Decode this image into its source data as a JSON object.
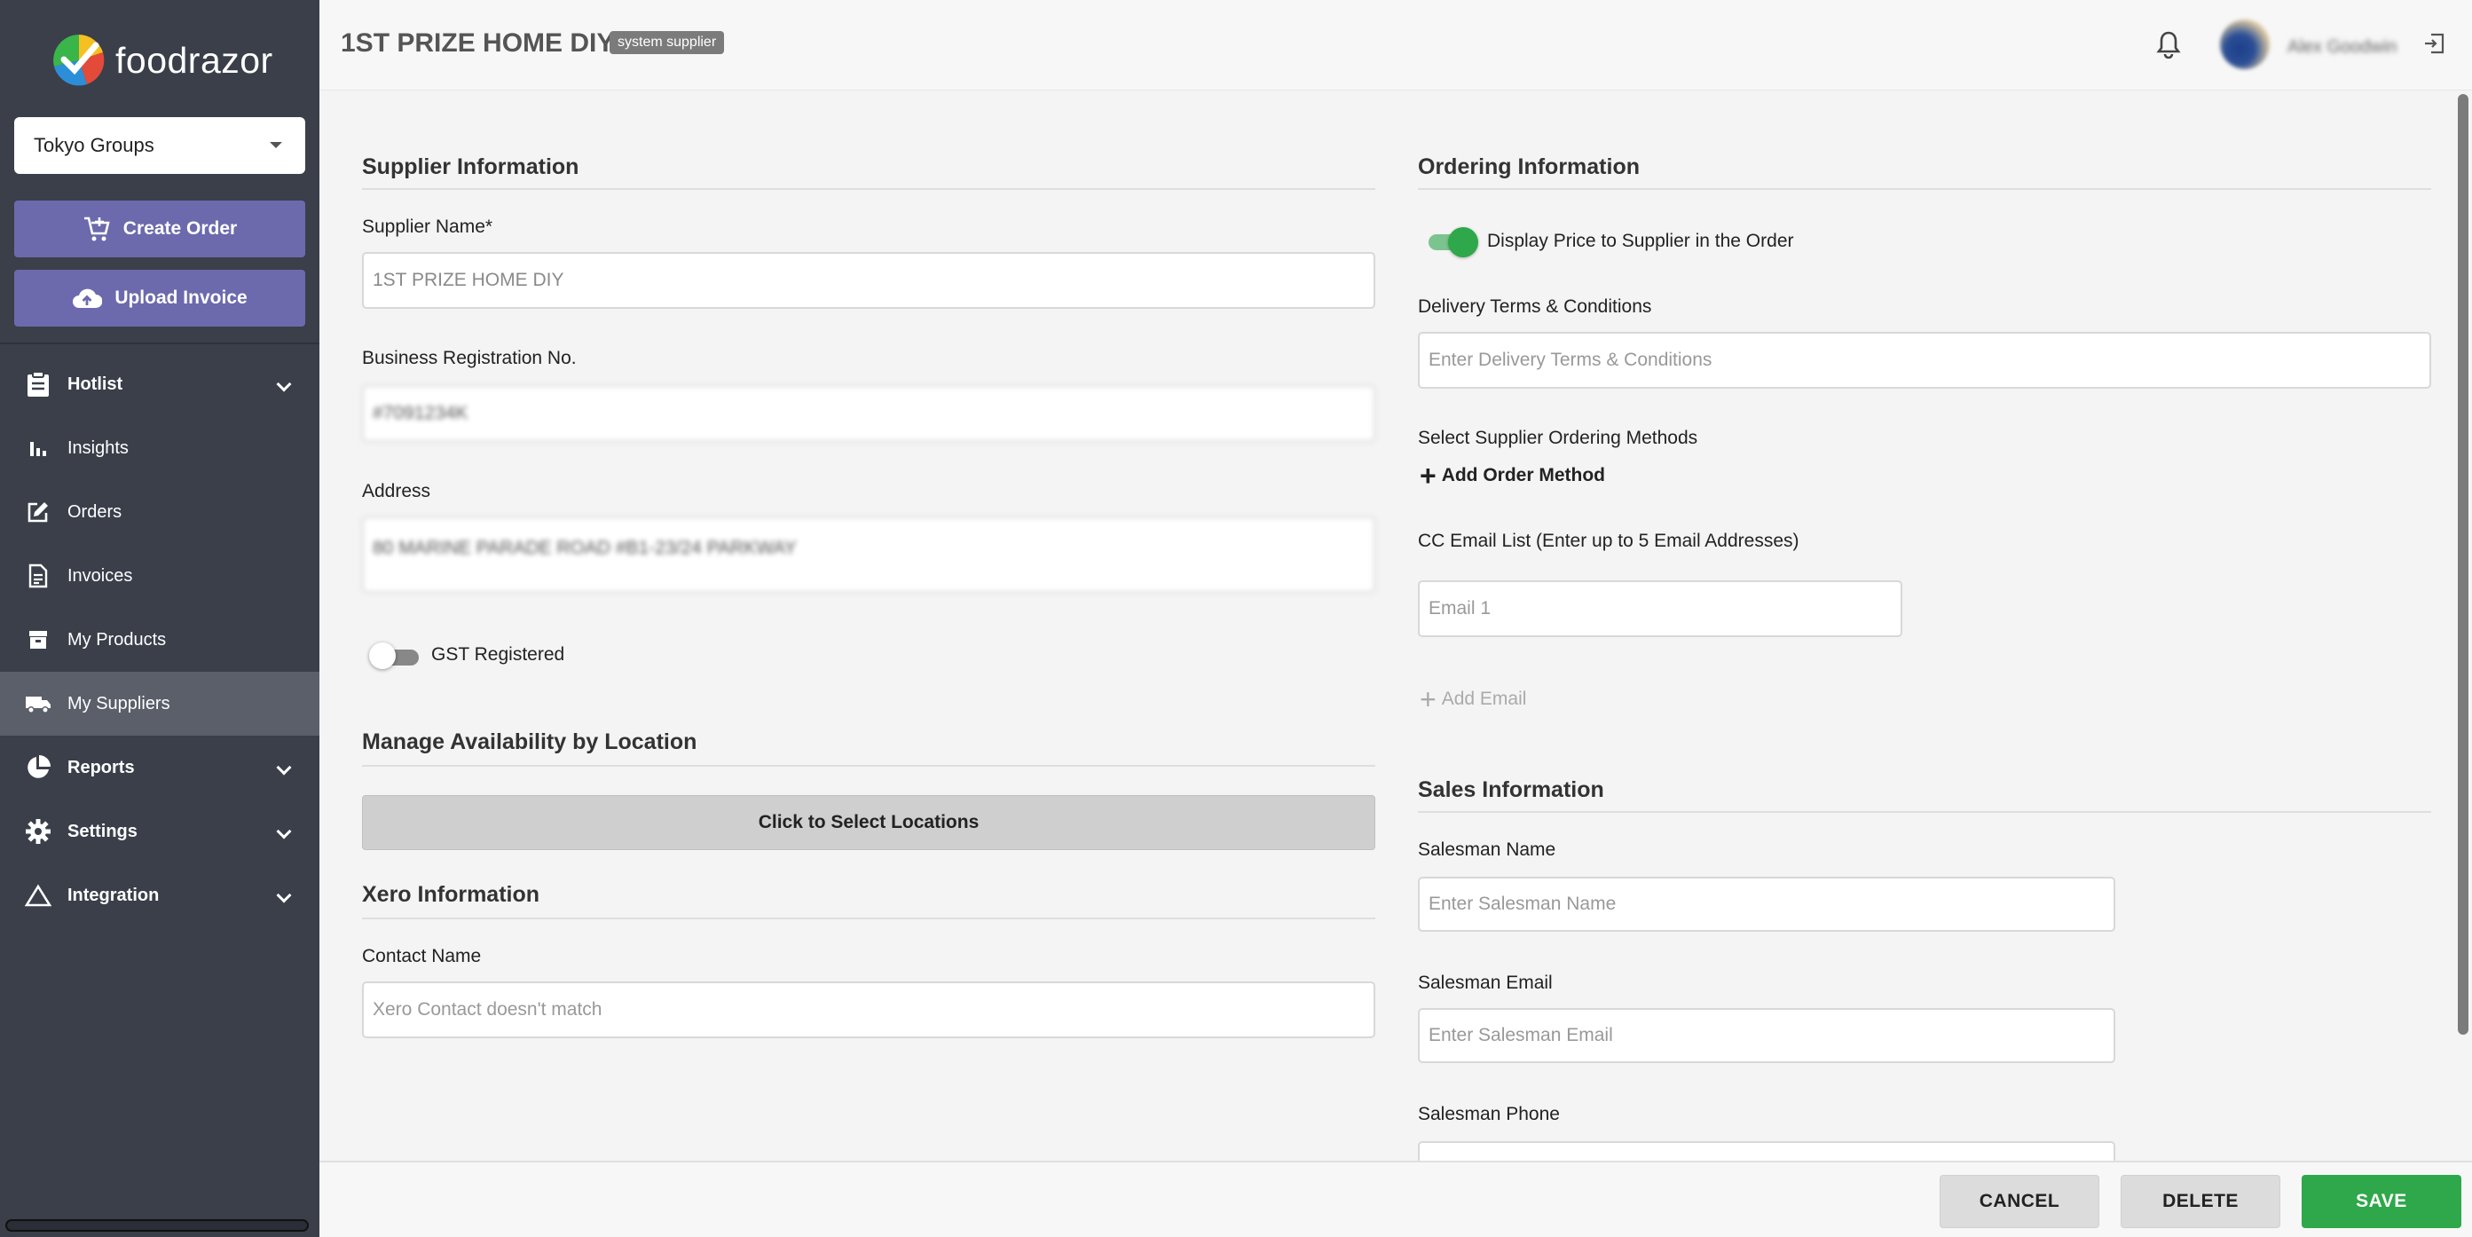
{
  "brand": {
    "name": "foodrazor"
  },
  "org_select": {
    "value": "Tokyo Groups"
  },
  "sidebar": {
    "create_order": "Create Order",
    "upload_invoice": "Upload Invoice",
    "items": [
      {
        "label": "Hotlist",
        "icon": "clipboard-icon"
      },
      {
        "label": "Insights",
        "icon": "bar-chart-icon"
      },
      {
        "label": "Orders",
        "icon": "edit-icon"
      },
      {
        "label": "Invoices",
        "icon": "invoice-icon"
      },
      {
        "label": "My Products",
        "icon": "box-icon"
      },
      {
        "label": "My Suppliers",
        "icon": "truck-icon"
      },
      {
        "label": "Reports",
        "icon": "pie-chart-icon"
      },
      {
        "label": "Settings",
        "icon": "gear-icon"
      },
      {
        "label": "Integration",
        "icon": "triangle-icon"
      }
    ]
  },
  "header": {
    "title": "1ST PRIZE HOME DIY",
    "badge": "system supplier",
    "username": "Alex Goodwin"
  },
  "supplier_info": {
    "title": "Supplier Information",
    "name_label": "Supplier Name*",
    "name_value": "1ST PRIZE HOME DIY",
    "brn_label": "Business Registration No.",
    "brn_value": "#7091234K",
    "address_label": "Address",
    "address_value": "80 MARINE PARADE ROAD #B1-23/24 PARKWAY",
    "gst_label": "GST Registered"
  },
  "availability": {
    "title": "Manage Availability by Location",
    "button": "Click to Select Locations"
  },
  "xero": {
    "title": "Xero Information",
    "contact_label": "Contact Name",
    "contact_placeholder": "Xero Contact doesn't match"
  },
  "ordering": {
    "title": "Ordering Information",
    "display_price_label": "Display Price to Supplier in the Order",
    "delivery_label": "Delivery Terms & Conditions",
    "delivery_placeholder": "Enter Delivery Terms & Conditions",
    "methods_label": "Select Supplier Ordering Methods",
    "add_method": "Add Order Method",
    "cc_label": "CC Email List (Enter up to 5 Email Addresses)",
    "email1_placeholder": "Email 1",
    "add_email": "Add Email"
  },
  "sales": {
    "title": "Sales Information",
    "name_label": "Salesman Name",
    "name_placeholder": "Enter Salesman Name",
    "email_label": "Salesman Email",
    "email_placeholder": "Enter Salesman Email",
    "phone_label": "Salesman Phone"
  },
  "footer": {
    "cancel": "CANCEL",
    "delete": "DELETE",
    "save": "SAVE"
  },
  "colors": {
    "sidebar": "#3a3f4a",
    "accent": "#6c6aad",
    "save": "#2ea84a"
  }
}
